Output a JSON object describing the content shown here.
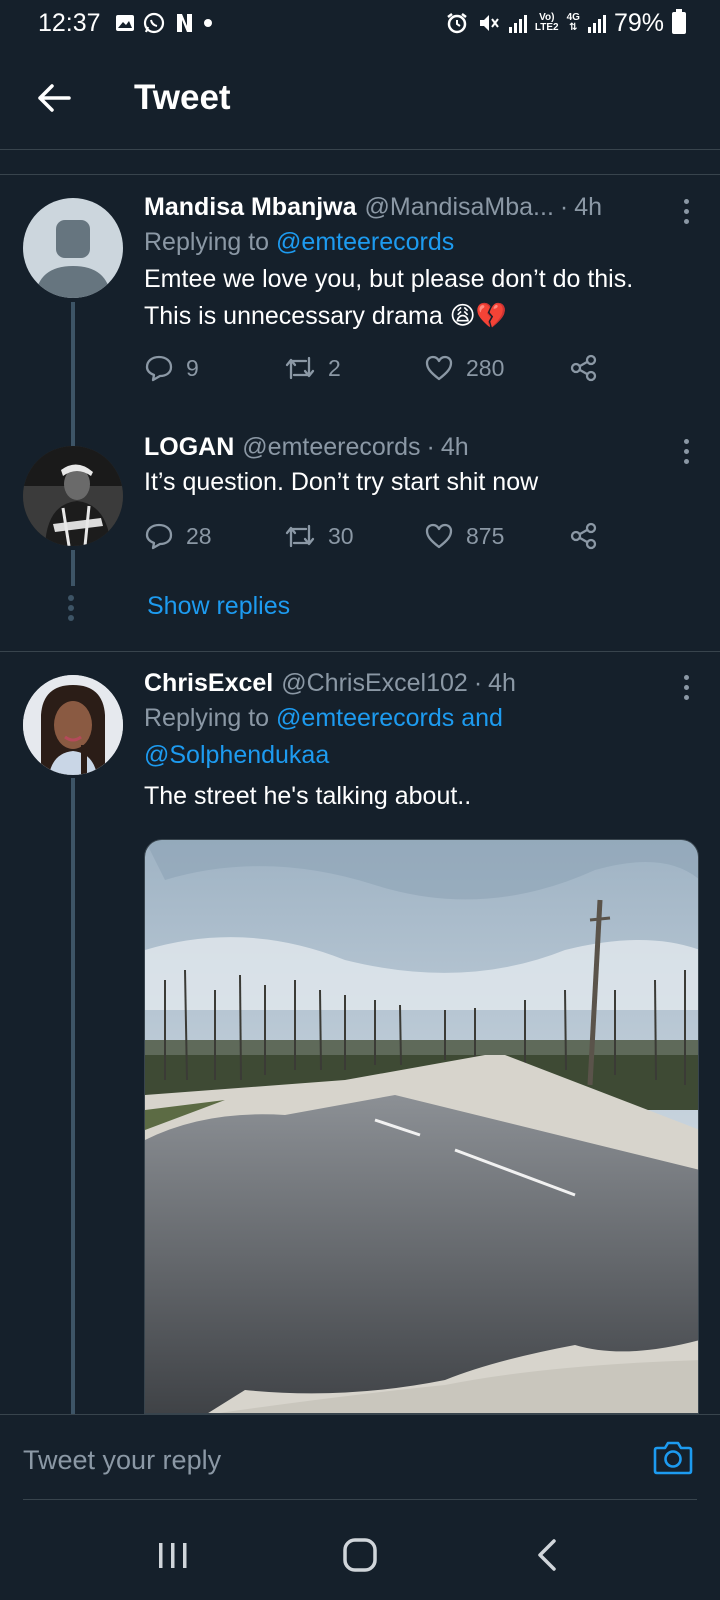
{
  "status_bar": {
    "time": "12:37",
    "battery": "79%",
    "network_top": "Vo)",
    "network_bottom": "LTE2",
    "net_type": "4G"
  },
  "header": {
    "title": "Tweet"
  },
  "tweets": [
    {
      "name": "Mandisa Mbanjwa",
      "handle": "@MandisaMba...",
      "time": "4h",
      "reply_prefix": "Replying to",
      "reply_to": "@emteerecords",
      "text_line1": "Emtee we love you, but please don’t do this.",
      "text_line2": "This is unnecessary drama 😩💔",
      "replies": "9",
      "retweets": "2",
      "likes": "280"
    },
    {
      "name": "LOGAN",
      "handle": "@emteerecords",
      "time": "4h",
      "text": "It’s question. Don’t try start shit now",
      "replies": "28",
      "retweets": "30",
      "likes": "875"
    },
    {
      "name": "ChrisExcel",
      "handle": "@ChrisExcel102",
      "time": "4h",
      "reply_prefix": "Replying to",
      "reply_to_1": "@emteerecords and",
      "reply_to_2": "@Solphendukaa",
      "text": "The street he's talking about.."
    }
  ],
  "show_replies": "Show replies",
  "reply_bar": {
    "placeholder": "Tweet your reply"
  },
  "colors": {
    "background": "#15202b",
    "accent": "#1d9bf0",
    "secondary_text": "#8b98a5",
    "border": "#38444d"
  }
}
